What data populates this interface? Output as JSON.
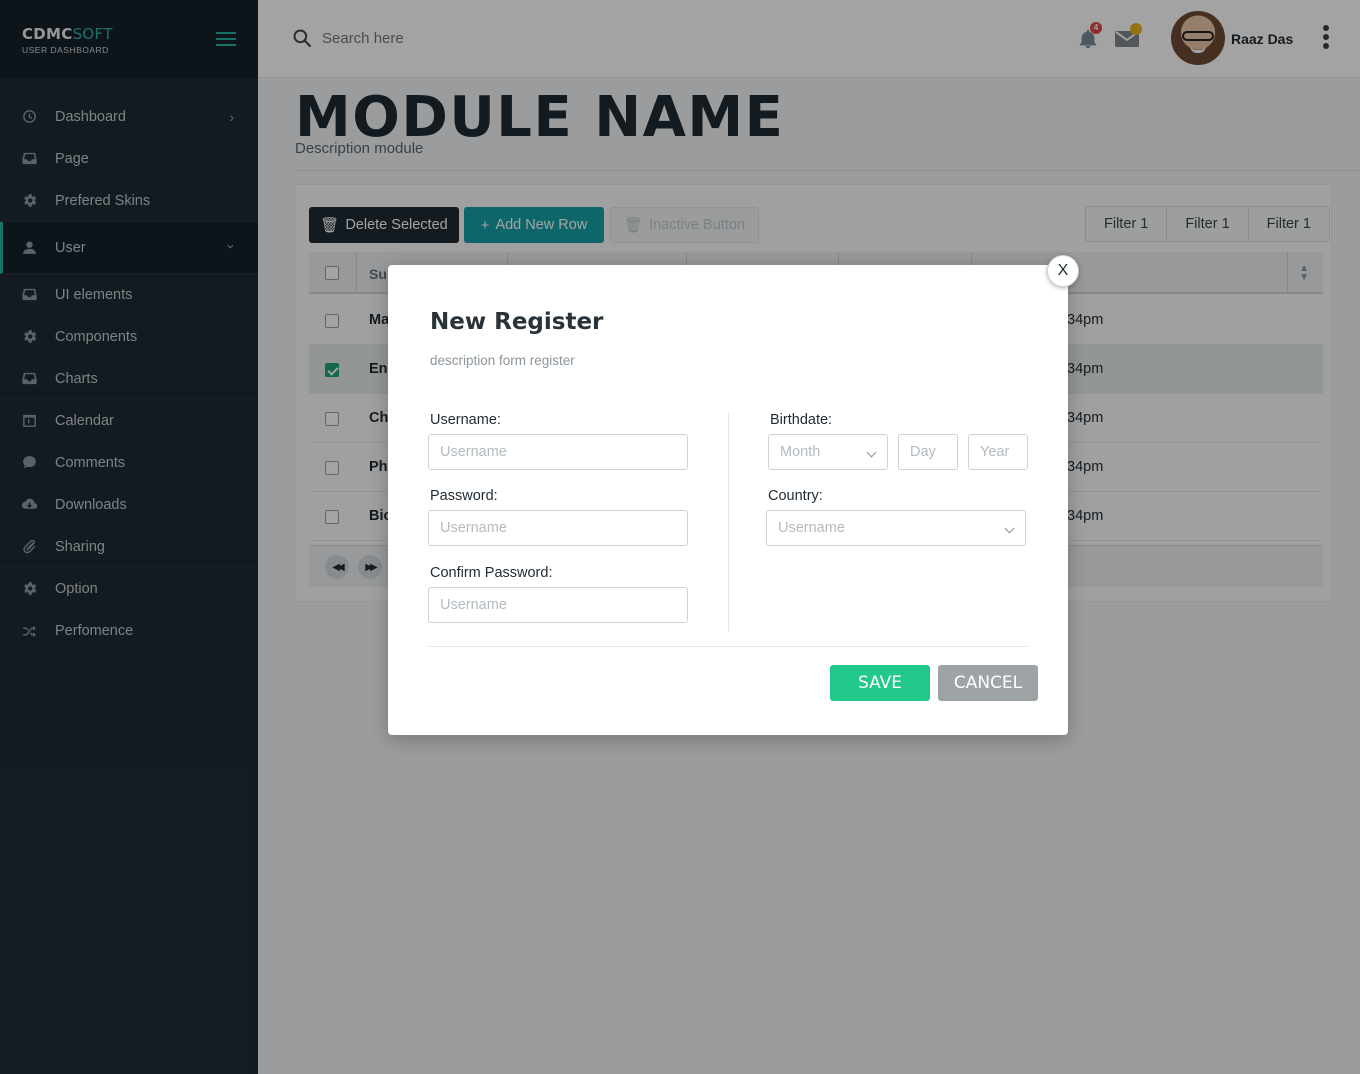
{
  "brand": {
    "name_primary": "CDMC",
    "name_accent": "SOFT",
    "subtitle": "USER DASHBOARD"
  },
  "sidebar": {
    "items": [
      {
        "label": "Dashboard",
        "icon": "dashboard-icon",
        "arrow": ">"
      },
      {
        "label": "Page",
        "icon": "inbox-icon"
      },
      {
        "label": "Prefered Skins",
        "icon": "gear-icon"
      },
      {
        "label": "User",
        "icon": "user-icon",
        "arrow": "⌄",
        "active": true
      },
      {
        "label": "UI elements",
        "icon": "inbox-icon"
      },
      {
        "label": "Components",
        "icon": "gear-icon"
      },
      {
        "label": "Charts",
        "icon": "inbox-icon"
      },
      {
        "label": "Calendar",
        "icon": "calendar-icon"
      },
      {
        "label": "Comments",
        "icon": "comment-icon"
      },
      {
        "label": "Downloads",
        "icon": "cloud-download-icon"
      },
      {
        "label": "Sharing",
        "icon": "paperclip-icon"
      },
      {
        "label": "Option",
        "icon": "gear-icon"
      },
      {
        "label": "Perfomence",
        "icon": "shuffle-icon"
      }
    ]
  },
  "topbar": {
    "search_placeholder": "Search here",
    "notifications_count": "4",
    "messages_count": "",
    "user_name": "Raaz Das"
  },
  "page": {
    "title": "MODULE NAME",
    "description": "Description module"
  },
  "toolbar": {
    "delete_label": "Delete Selected",
    "add_label": "Add New Row",
    "inactive_label": "Inactive Button",
    "filters": [
      "Filter 1",
      "Filter 1",
      "Filter 1"
    ]
  },
  "table": {
    "header_first": "Su",
    "rows": [
      {
        "subject": "Ma",
        "time": "34pm",
        "checked": false
      },
      {
        "subject": "Eng",
        "time": "34pm",
        "checked": true
      },
      {
        "subject": "Che",
        "time": "34pm",
        "checked": false
      },
      {
        "subject": "Phy",
        "time": "34pm",
        "checked": false
      },
      {
        "subject": "Bio",
        "time": "34pm",
        "checked": false
      }
    ]
  },
  "modal": {
    "close_label": "X",
    "title": "New Register",
    "description": "description form register",
    "username_label": "Username:",
    "username_placeholder": "Username",
    "password_label": "Password:",
    "password_placeholder": "Username",
    "confirm_label": "Confirm Password:",
    "confirm_placeholder": "Username",
    "birthdate_label": "Birthdate:",
    "month_placeholder": "Month",
    "day_placeholder": "Day",
    "year_placeholder": "Year",
    "country_label": "Country:",
    "country_placeholder": "Username",
    "save_label": "SAVE",
    "cancel_label": "CANCEL"
  },
  "colors": {
    "sidebar_bg": "#1f2b33",
    "accent": "#2ab1a6",
    "add_button": "#17a0a8",
    "save_button": "#21c98a",
    "cancel_button": "#9ea3a6",
    "notification_badge": "#e04848",
    "message_badge": "#e8b21d"
  }
}
